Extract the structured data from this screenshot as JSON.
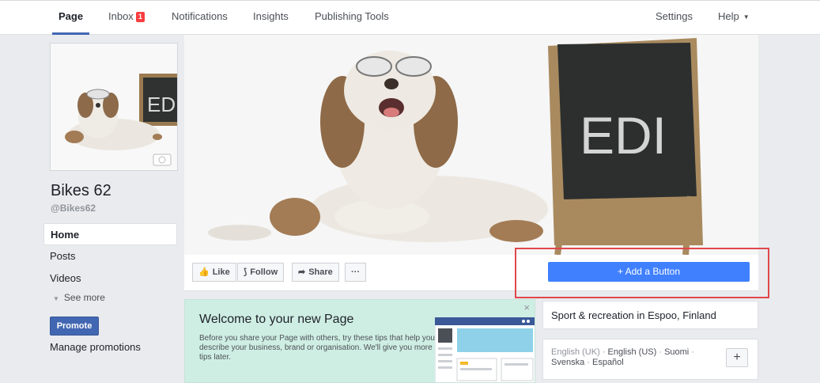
{
  "nav": {
    "page": "Page",
    "inbox": "Inbox",
    "inbox_badge": "1",
    "notifications": "Notifications",
    "insights": "Insights",
    "publishing_tools": "Publishing Tools",
    "settings": "Settings",
    "help": "Help"
  },
  "profile": {
    "name": "Bikes 62",
    "handle": "@Bikes62",
    "board_text": "EDI"
  },
  "menu": {
    "home": "Home",
    "posts": "Posts",
    "videos": "Videos",
    "see_more": "See more",
    "promote": "Promote",
    "manage_promotions": "Manage promotions"
  },
  "cover": {
    "board_text": "EDI"
  },
  "actions": {
    "like": "Like",
    "follow": "Follow",
    "share": "Share",
    "more": "···",
    "add_button": "+ Add a Button"
  },
  "welcome": {
    "title": "Welcome to your new Page",
    "body": "Before you share your Page with others, try these tips that help you describe your business, brand or organisation. We'll give you more tips later.",
    "close": "×"
  },
  "about": {
    "category": "Sport & recreation in Espoo, Finland"
  },
  "languages": {
    "english_uk": "English (UK)",
    "english_us": "English (US)",
    "suomi": "Suomi",
    "svenska": "Svenska",
    "espanol": "Español",
    "separator": " · ",
    "plus": "+"
  },
  "colors": {
    "brand_blue": "#4267b2",
    "add_button_blue": "#4080ff",
    "highlight_red": "#e0474c",
    "welcome_bg": "#cfeee3"
  }
}
